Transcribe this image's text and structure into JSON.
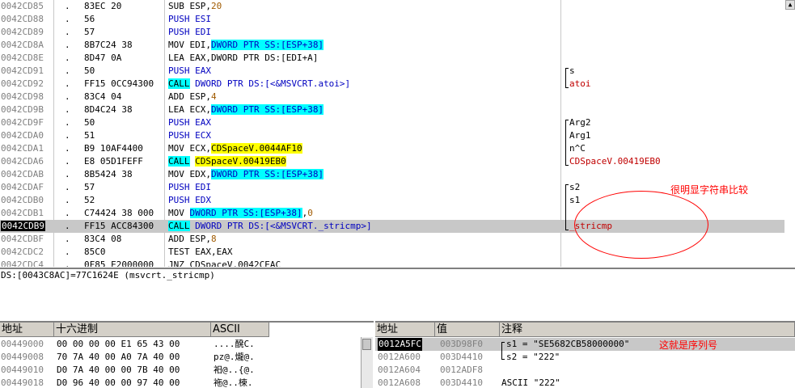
{
  "disasm": {
    "rows": [
      {
        "addr": "0042CD85",
        "dot": ".",
        "bytes": "83EC 20",
        "instr": [
          {
            "t": "SUB ESP,"
          },
          {
            "t": "20",
            "c": "num-brown"
          }
        ],
        "comment": ""
      },
      {
        "addr": "0042CD88",
        "dot": ".",
        "bytes": "56",
        "instr": [
          {
            "t": "PUSH ESI",
            "c": "blue"
          }
        ],
        "comment": ""
      },
      {
        "addr": "0042CD89",
        "dot": ".",
        "bytes": "57",
        "instr": [
          {
            "t": "PUSH EDI",
            "c": "blue"
          }
        ],
        "comment": ""
      },
      {
        "addr": "0042CD8A",
        "dot": ".",
        "bytes": "8B7C24 38",
        "instr": [
          {
            "t": "MOV EDI,"
          },
          {
            "t": "DWORD PTR SS:[ESP+38]",
            "c": "hl-cyan"
          }
        ],
        "comment": ""
      },
      {
        "addr": "0042CD8E",
        "dot": ".",
        "bytes": "8D47 0A",
        "instr": [
          {
            "t": "LEA EAX,DWORD PTR DS:[EDI+A]"
          }
        ],
        "comment": ""
      },
      {
        "addr": "0042CD91",
        "dot": ".",
        "bytes": "50",
        "instr": [
          {
            "t": "PUSH EAX",
            "c": "blue"
          }
        ],
        "comment": "s"
      },
      {
        "addr": "0042CD92",
        "dot": ".",
        "bytes": "FF15 0CC94300",
        "instr": [
          {
            "t": "CALL",
            "c": "hl-callkw"
          },
          {
            "t": " DWORD PTR DS:[<&MSVCRT.atoi>]",
            "c": "blue"
          }
        ],
        "comment": "atoi",
        "commentClass": "red"
      },
      {
        "addr": "0042CD98",
        "dot": ".",
        "bytes": "83C4 04",
        "instr": [
          {
            "t": "ADD ESP,"
          },
          {
            "t": "4",
            "c": "num-brown"
          }
        ],
        "comment": ""
      },
      {
        "addr": "0042CD9B",
        "dot": ".",
        "bytes": "8D4C24 38",
        "instr": [
          {
            "t": "LEA ECX,"
          },
          {
            "t": "DWORD PTR SS:[ESP+38]",
            "c": "hl-cyan"
          }
        ],
        "comment": ""
      },
      {
        "addr": "0042CD9F",
        "dot": ".",
        "bytes": "50",
        "instr": [
          {
            "t": "PUSH EAX",
            "c": "blue"
          }
        ],
        "comment": "Arg2"
      },
      {
        "addr": "0042CDA0",
        "dot": ".",
        "bytes": "51",
        "instr": [
          {
            "t": "PUSH ECX",
            "c": "blue"
          }
        ],
        "comment": "Arg1"
      },
      {
        "addr": "0042CDA1",
        "dot": ".",
        "bytes": "B9 10AF4400",
        "instr": [
          {
            "t": "MOV ECX,"
          },
          {
            "t": "CDSpaceV.0044AF10",
            "c": "hl-yellow"
          }
        ],
        "comment": "n^C"
      },
      {
        "addr": "0042CDA6",
        "dot": ".",
        "bytes": "E8 05D1FEFF",
        "instr": [
          {
            "t": "CALL",
            "c": "hl-callkw"
          },
          {
            "t": " "
          },
          {
            "t": "CDSpaceV.00419EB0",
            "c": "hl-yellow"
          }
        ],
        "comment": "CDSpaceV.00419EB0",
        "commentClass": "red"
      },
      {
        "addr": "0042CDAB",
        "dot": ".",
        "bytes": "8B5424 38",
        "instr": [
          {
            "t": "MOV EDX,"
          },
          {
            "t": "DWORD PTR SS:[ESP+38]",
            "c": "hl-cyan"
          }
        ],
        "comment": ""
      },
      {
        "addr": "0042CDAF",
        "dot": ".",
        "bytes": "57",
        "instr": [
          {
            "t": "PUSH EDI",
            "c": "blue"
          }
        ],
        "comment": "s2"
      },
      {
        "addr": "0042CDB0",
        "dot": ".",
        "bytes": "52",
        "instr": [
          {
            "t": "PUSH EDX",
            "c": "blue"
          }
        ],
        "comment": "s1"
      },
      {
        "addr": "0042CDB1",
        "dot": ".",
        "bytes": "C74424 38 000",
        "instr": [
          {
            "t": "MOV "
          },
          {
            "t": "DWORD PTR SS:[ESP+38]",
            "c": "hl-cyan"
          },
          {
            "t": ","
          },
          {
            "t": "0",
            "c": "num-brown"
          }
        ],
        "comment": ""
      },
      {
        "addr": "0042CDB9",
        "dot": ".",
        "bytes": "FF15 ACC84300",
        "instr": [
          {
            "t": "CALL",
            "c": "hl-callkw"
          },
          {
            "t": " DWORD PTR DS:[<&MSVCRT._stricmp>]",
            "c": "blue"
          }
        ],
        "comment": "_stricmp",
        "commentClass": "red",
        "selected": true
      },
      {
        "addr": "0042CDBF",
        "dot": ".",
        "bytes": "83C4 08",
        "instr": [
          {
            "t": "ADD ESP,"
          },
          {
            "t": "8",
            "c": "num-brown"
          }
        ],
        "comment": ""
      },
      {
        "addr": "0042CDC2",
        "dot": ".",
        "bytes": "85C0",
        "instr": [
          {
            "t": "TEST EAX,EAX"
          }
        ],
        "comment": ""
      },
      {
        "addr": "0042CDC4",
        "dot": ".",
        "bytes": "0F85 E2000000",
        "instr": [
          {
            "t": "JNZ CDSpaceV.0042CEAC"
          }
        ],
        "comment": ""
      }
    ]
  },
  "info": {
    "line": "DS:[0043C8AC]=77C1624E (msvcrt._stricmp)"
  },
  "dump": {
    "headers": {
      "address": "地址",
      "hex": "十六进制",
      "ascii": "ASCII"
    },
    "rows": [
      {
        "addr": "00449000",
        "hex": "00 00 00 00 E1 65 43 00",
        "ascii": "....醗C."
      },
      {
        "addr": "00449008",
        "hex": "70 7A 40 00 A0 7A 40 00",
        "ascii": "pz@.爖@."
      },
      {
        "addr": "00449010",
        "hex": "D0 7A 40 00 00 7B 40 00",
        "ascii": "衵@..{@."
      },
      {
        "addr": "00449018",
        "hex": "D0 96 40 00 00 97 40 00",
        "ascii": "袘@..梀."
      }
    ]
  },
  "stack": {
    "headers": {
      "address": "地址",
      "value": "值",
      "comment": "注释"
    },
    "rows": [
      {
        "addr": "0012A5FC",
        "value": "003D98F0",
        "comment": "s1 = \"SE5682CB58000000\"",
        "selected": true
      },
      {
        "addr": "0012A600",
        "value": "003D4410",
        "comment": "s2 = \"222\""
      },
      {
        "addr": "0012A604",
        "value": "0012ADF8",
        "comment": ""
      },
      {
        "addr": "0012A608",
        "value": "003D4410",
        "comment": "ASCII \"222\""
      }
    ]
  },
  "annotations": {
    "compare_note": "很明显字符串比较",
    "serial_note": "这就是序列号"
  },
  "colors": {
    "annotation": "#ff0000",
    "cyan_highlight": "#00ffff",
    "yellow_highlight": "#ffff00",
    "selection": "#c8c8c8"
  }
}
